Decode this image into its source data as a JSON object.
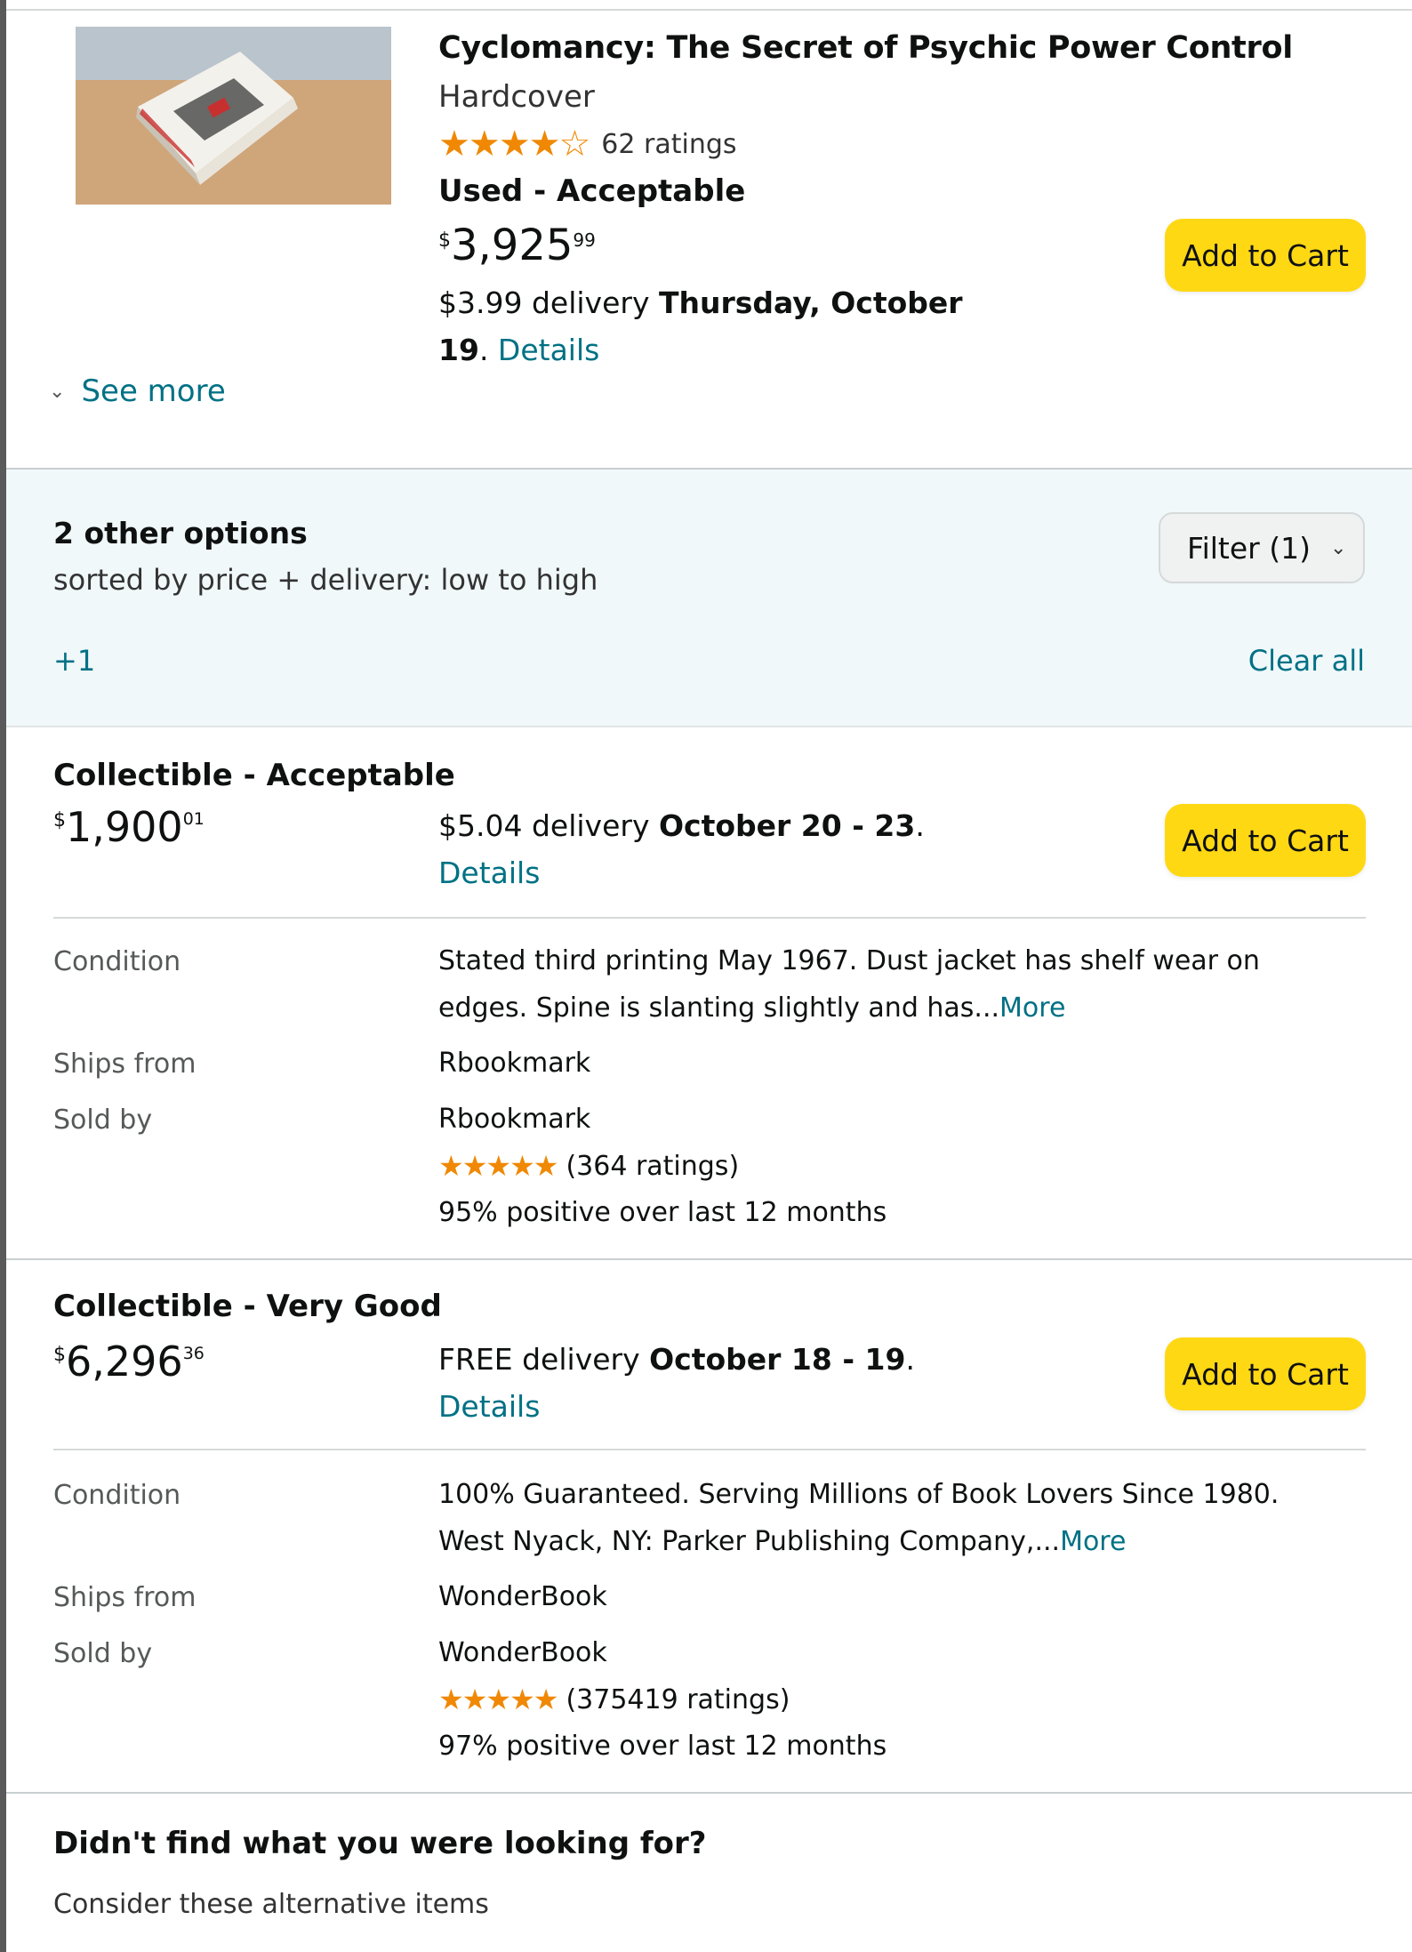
{
  "product": {
    "title": "Cyclomancy: The Secret of Psychic Power Control",
    "format": "Hardcover",
    "stars": "★★★★☆",
    "ratings": "62 ratings",
    "rating_value": 4,
    "condition": "Used - Acceptable",
    "price_symbol": "$",
    "price_whole": "3,925",
    "price_fraction": "99",
    "delivery_prefix": "$3.99 delivery ",
    "delivery_date": "Thursday, October 19",
    "delivery_suffix": ". ",
    "details_link": "Details",
    "add_to_cart": "Add to Cart",
    "see_more": "See more"
  },
  "options": {
    "title": "2 other options",
    "subtitle": "sorted by price + delivery: low to high",
    "filter_label": "Filter (1)",
    "plus_one": "+1",
    "clear_all": "Clear all"
  },
  "offers": [
    {
      "condition": "Collectible - Acceptable",
      "price_symbol": "$",
      "price_whole": "1,900",
      "price_fraction": "01",
      "delivery_prefix": "$5.04 delivery ",
      "delivery_date": "October 20 - 23",
      "delivery_suffix": ".",
      "details_link": "Details",
      "add_to_cart": "Add to Cart",
      "condition_label": "Condition",
      "condition_text": "Stated third printing May 1967. Dust jacket has shelf wear on edges. Spine is slanting slightly and has...",
      "more_link": "More",
      "ships_from_label": "Ships from",
      "ships_from": "Rbookmark",
      "sold_by_label": "Sold by",
      "sold_by": "Rbookmark",
      "seller_stars": "★★★★★",
      "seller_ratings": "(364 ratings)",
      "seller_positive": "95% positive over last 12 months"
    },
    {
      "condition": "Collectible - Very Good",
      "price_symbol": "$",
      "price_whole": "6,296",
      "price_fraction": "36",
      "delivery_prefix": "FREE delivery ",
      "delivery_date": "October 18 - 19",
      "delivery_suffix": ".",
      "details_link": "Details",
      "add_to_cart": "Add to Cart",
      "condition_label": "Condition",
      "condition_text": "100% Guaranteed. Serving Millions of Book Lovers Since 1980. West Nyack, NY: Parker Publishing Company,...",
      "more_link": "More",
      "ships_from_label": "Ships from",
      "ships_from": "WonderBook",
      "sold_by_label": "Sold by",
      "sold_by": "WonderBook",
      "seller_stars": "★★★★★",
      "seller_ratings": "(375419 ratings)",
      "seller_positive": "97% positive over last 12 months"
    }
  ],
  "footer": {
    "title": "Didn't find what you were looking for?",
    "subtitle": "Consider these alternative items"
  },
  "colors": {
    "button": "#ffd814",
    "link": "#007185",
    "star": "#f08804",
    "band": "#f0f8fa"
  },
  "icons": {
    "see_more": "chevron-down-icon",
    "filter": "chevron-down-icon"
  }
}
